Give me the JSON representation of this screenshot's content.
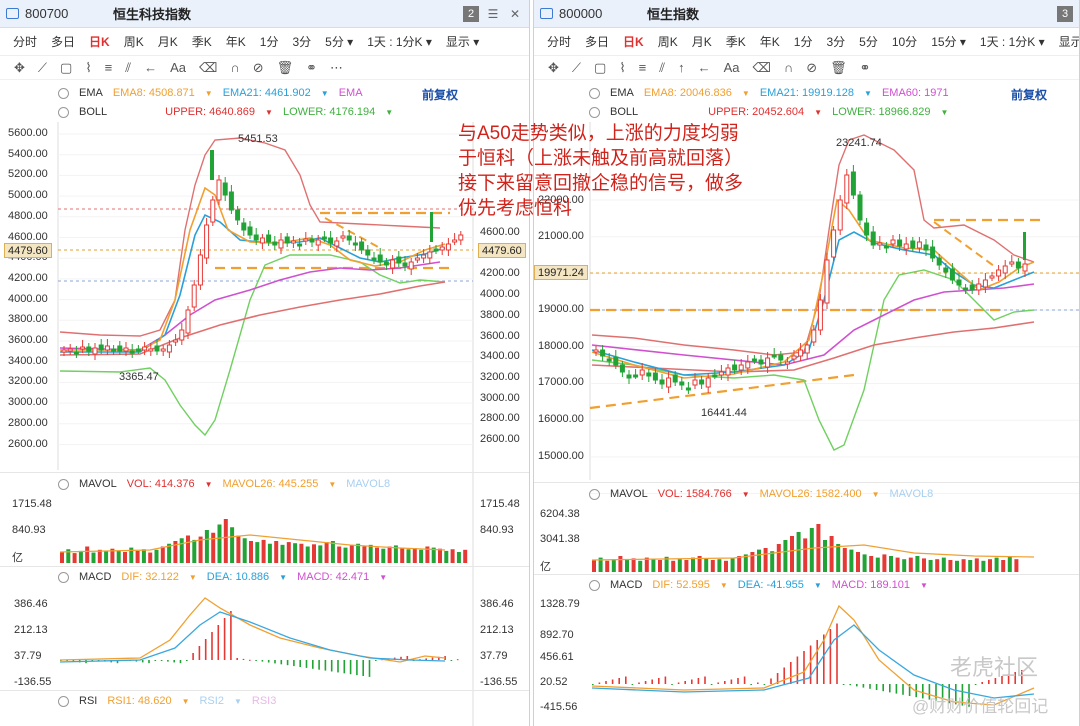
{
  "left": {
    "code": "800700",
    "name": "恒生科技指数",
    "badge": "2",
    "periods": [
      "分时",
      "多日",
      "日K",
      "周K",
      "月K",
      "季K",
      "年K",
      "1分",
      "3分",
      "5分 ▾",
      "1天 : 1分K ▾",
      "显示 ▾"
    ],
    "active_period": "日K",
    "ema": {
      "name": "EMA",
      "v1": "EMA8: 4508.871",
      "v2": "EMA21: 4461.902",
      "v3": "EMA"
    },
    "boll": {
      "name": "BOLL",
      "upper": "UPPER: 4640.869",
      "lower": "LOWER: 4176.194"
    },
    "fuquan": "前复权",
    "y_ticks": [
      "5600.00",
      "5400.00",
      "5200.00",
      "5000.00",
      "4800.00",
      "4600.00",
      "4400.00",
      "4200.00",
      "4000.00",
      "3800.00",
      "3600.00",
      "3400.00",
      "3200.00",
      "3000.00",
      "2800.00",
      "2600.00"
    ],
    "y_ticks_right": [
      "4600.00",
      "4200.00",
      "4000.00",
      "3800.00",
      "3600.00",
      "3400.00",
      "3200.00",
      "3000.00",
      "2800.00",
      "2600.00"
    ],
    "price": "4479.60",
    "high": "5451.53",
    "low": "3365.47",
    "mavol": {
      "name": "MAVOL",
      "vol": "VOL: 414.376",
      "ma26": "MAVOL26: 445.255",
      "ma8": "MAVOL8"
    },
    "vol_ticks": [
      "1715.48",
      "840.93",
      "亿"
    ],
    "macd": {
      "name": "MACD",
      "dif": "DIF: 32.122",
      "dea": "DEA: 10.886",
      "macd": "MACD: 42.471"
    },
    "macd_ticks": [
      "386.46",
      "212.13",
      "37.79",
      "-136.55"
    ],
    "rsi": {
      "name": "RSI",
      "r1": "RSI1: 48.620",
      "r2": "RSI2",
      "r3": "RSI3"
    }
  },
  "right": {
    "code": "800000",
    "name": "恒生指数",
    "periods": [
      "分时",
      "多日",
      "日K",
      "周K",
      "月K",
      "季K",
      "年K",
      "1分",
      "3分",
      "5分",
      "10分",
      "15分 ▾",
      "1天 : 1分K ▾",
      "显示 ▾"
    ],
    "active_period": "日K",
    "ema": {
      "name": "EMA",
      "v1": "EMA8: 20046.836",
      "v2": "EMA21: 19919.128",
      "v3": "EMA60: 1971"
    },
    "boll": {
      "name": "BOLL",
      "upper": "UPPER: 20452.604",
      "lower": "LOWER: 18966.829"
    },
    "fuquan": "前复权",
    "y_ticks": [
      "22000.00",
      "21000.00",
      "19000.00",
      "18000.00",
      "17000.00",
      "16000.00",
      "15000.00"
    ],
    "price": "19971.24",
    "high": "23241.74",
    "low": "16441.44",
    "mavol": {
      "name": "MAVOL",
      "vol": "VOL: 1584.766",
      "ma26": "MAVOL26: 1582.400",
      "ma8": "MAVOL8"
    },
    "vol_ticks": [
      "6204.38",
      "3041.38",
      "亿"
    ],
    "macd": {
      "name": "MACD",
      "dif": "DIF: 52.595",
      "dea": "DEA: -41.955",
      "macd": "MACD: 189.101"
    },
    "macd_ticks": [
      "1328.79",
      "892.70",
      "456.61",
      "20.52",
      "-415.56"
    ]
  },
  "annotation": "与A50走势类似，上涨的力度均弱于恒科（上涨未触及前高就回落）接下来留意回撤企稳的信号，做多优先考虑恒科",
  "watermark1": "老虎社区",
  "watermark2": "@财财价值轮回记",
  "colors": {
    "up": "#e53935",
    "down": "#21a336",
    "ema8": "#f0a030",
    "ema21": "#2aa0d8",
    "ema60": "#d050d0",
    "boll_up": "#e07070",
    "boll_low": "#70d060",
    "dif": "#f0a030",
    "dea": "#3aa8e0"
  }
}
